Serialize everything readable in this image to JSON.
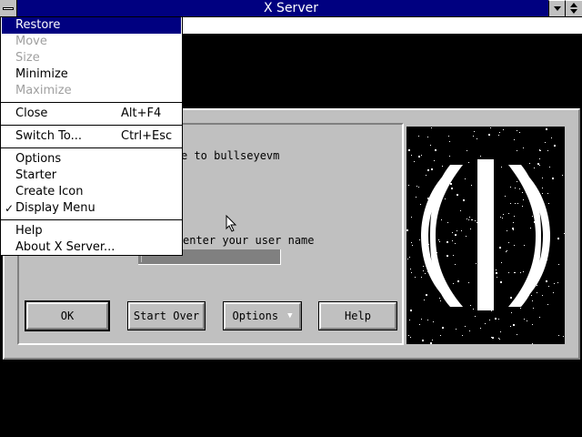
{
  "window": {
    "title": "X Server"
  },
  "system_menu": {
    "items": [
      {
        "label": "Restore",
        "state": "selected"
      },
      {
        "label": "Move",
        "state": "disabled"
      },
      {
        "label": "Size",
        "state": "disabled"
      },
      {
        "label": "Minimize",
        "state": "enabled"
      },
      {
        "label": "Maximize",
        "state": "disabled"
      },
      {
        "label": "Close",
        "shortcut": "Alt+F4",
        "state": "enabled"
      },
      {
        "label": "Switch To...",
        "shortcut": "Ctrl+Esc",
        "state": "enabled"
      },
      {
        "label": "Options",
        "state": "enabled"
      },
      {
        "label": "Starter",
        "state": "enabled"
      },
      {
        "label": "Create Icon",
        "state": "enabled"
      },
      {
        "label": "Display Menu",
        "state": "checked"
      },
      {
        "label": "Help",
        "state": "enabled"
      },
      {
        "label": "About X Server...",
        "state": "enabled"
      }
    ],
    "check_mark": "✓"
  },
  "dialog": {
    "welcome_text": "e to bullseyevm",
    "prompt_text": "enter your user name",
    "username_value": "",
    "buttons": {
      "ok": "OK",
      "start_over": "Start Over",
      "options": "Options",
      "help": "Help"
    }
  },
  "colors": {
    "title_bar": "#000080",
    "dialog_bg": "#c0c0c0",
    "selection": "#000080"
  },
  "icons": [
    "system-menu-icon",
    "minimize-icon",
    "maximize-icon",
    "dropdown-arrow-icon",
    "mouse-cursor-icon",
    "logo-image"
  ]
}
